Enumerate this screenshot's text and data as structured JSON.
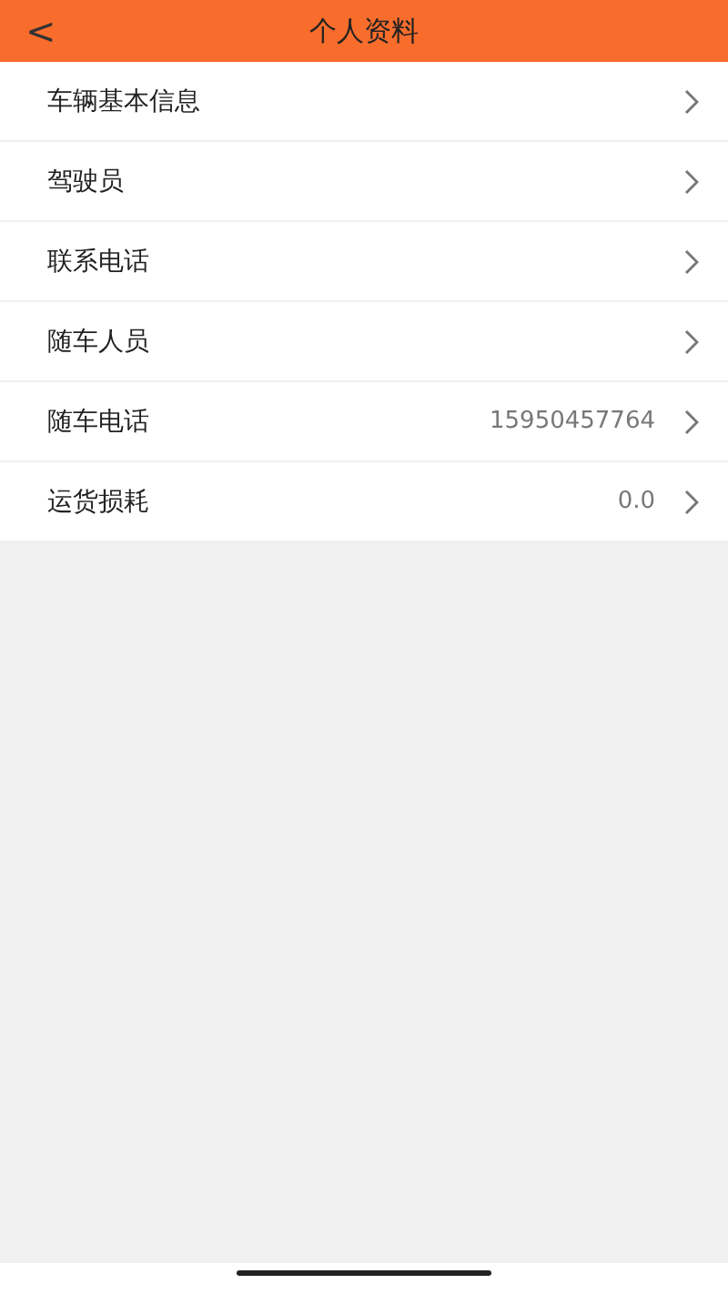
{
  "header": {
    "back": "<",
    "title": "个人资料"
  },
  "rows": [
    {
      "label": "车辆基本信息"
    },
    {
      "label": "驾驶员"
    },
    {
      "label": "联系电话"
    },
    {
      "label": "随车人员"
    },
    {
      "label": "随车电话",
      "value": "15950457764"
    },
    {
      "label": "运货损耗",
      "value": "0.0"
    }
  ]
}
